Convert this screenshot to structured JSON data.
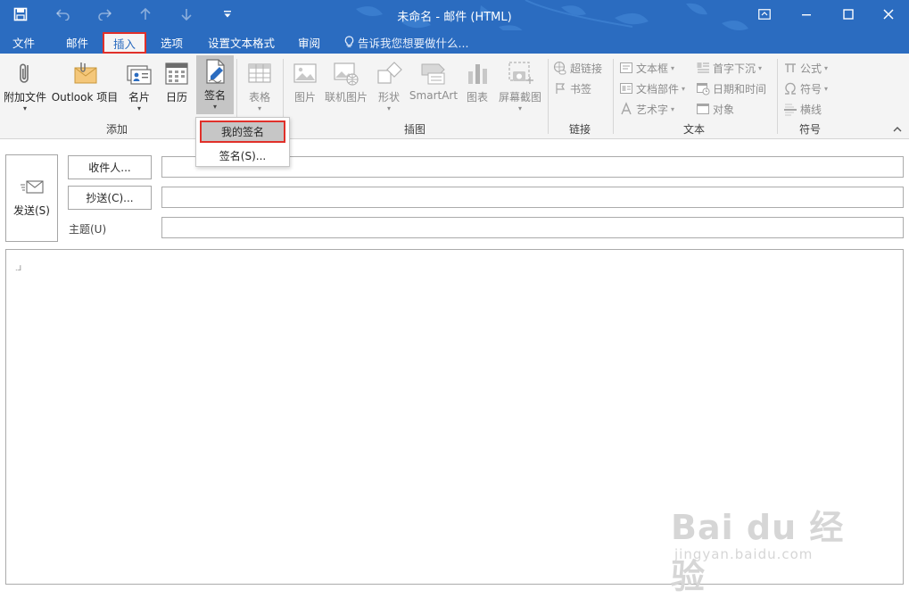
{
  "window": {
    "title": "未命名 - 邮件 (HTML)"
  },
  "tabs": [
    {
      "label": "文件"
    },
    {
      "label": "邮件"
    },
    {
      "label": "插入"
    },
    {
      "label": "选项"
    },
    {
      "label": "设置文本格式"
    },
    {
      "label": "审阅"
    }
  ],
  "tellme": {
    "label": "告诉我您想要做什么..."
  },
  "ribbon": {
    "groups": {
      "add": "添加",
      "illustrations": "插图",
      "links": "链接",
      "text": "文本",
      "symbols": "符号"
    },
    "add": {
      "attach_file": "附加文件",
      "outlook_item": "Outlook 项目",
      "business_card": "名片",
      "calendar": "日历",
      "signature": "签名"
    },
    "tables": {
      "table": "表格"
    },
    "illustrations": {
      "pictures": "图片",
      "online_pictures": "联机图片",
      "shapes": "形状",
      "smartart": "SmartArt",
      "chart": "图表",
      "screenshot": "屏幕截图"
    },
    "links": {
      "hyperlink": "超链接",
      "bookmark": "书签"
    },
    "text": {
      "textbox": "文本框",
      "quick_parts": "文档部件",
      "wordart": "艺术字",
      "drop_cap": "首字下沉",
      "date_time": "日期和时间",
      "object": "对象"
    },
    "symbols": {
      "equation": "公式",
      "symbol": "符号",
      "horizontal_line": "横线"
    }
  },
  "signature_menu": {
    "my_signature": "我的签名",
    "signatures": "签名(S)..."
  },
  "compose": {
    "send": "发送(S)",
    "to_button": "收件人...",
    "cc_button": "抄送(C)...",
    "subject_label": "主题(U)",
    "to_value": "",
    "cc_value": "",
    "subject_value": "",
    "body_mark": ".⅃"
  },
  "watermark": {
    "brand": "Bai du 经验",
    "url": "jingyan.baidu.com"
  },
  "colors": {
    "accent": "#2b6cc0",
    "highlight_border": "#e0302a"
  }
}
